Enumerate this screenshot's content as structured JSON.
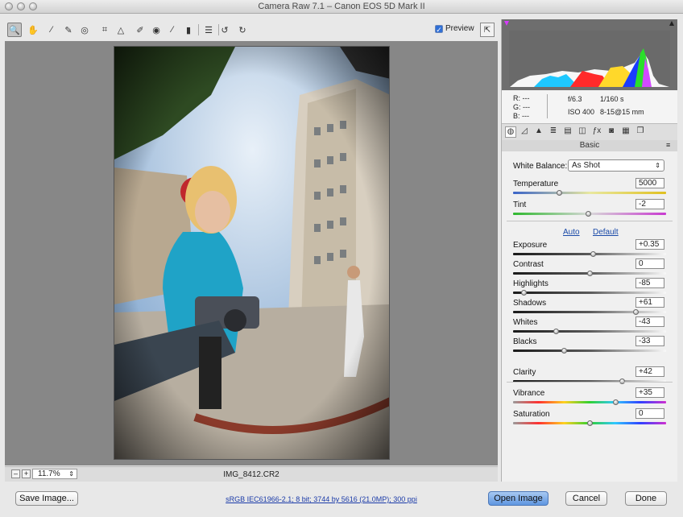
{
  "window": {
    "title": "Camera Raw 7.1  –  Canon EOS 5D Mark II"
  },
  "toolbar": {
    "tools": [
      {
        "name": "zoom-tool",
        "glyph": "🔍",
        "active": true
      },
      {
        "name": "hand-tool",
        "glyph": "✋"
      },
      {
        "name": "white-balance-tool",
        "glyph": "⁄"
      },
      {
        "name": "color-sampler-tool",
        "glyph": "✎"
      },
      {
        "name": "targeted-adjustment-tool",
        "glyph": "◎"
      },
      {
        "name": "crop-tool",
        "glyph": "⌗"
      },
      {
        "name": "straighten-tool",
        "glyph": "△"
      },
      {
        "name": "spot-removal-tool",
        "glyph": "✐"
      },
      {
        "name": "red-eye-tool",
        "glyph": "◉"
      },
      {
        "name": "adjustment-brush-tool",
        "glyph": "∕"
      },
      {
        "name": "graduated-filter-tool",
        "glyph": "▮"
      },
      {
        "name": "preferences-tool",
        "glyph": "☰"
      },
      {
        "name": "rotate-left-tool",
        "glyph": "↺"
      },
      {
        "name": "rotate-right-tool",
        "glyph": "↻"
      }
    ],
    "preview_label": "Preview",
    "preview_checked": true
  },
  "statusbar": {
    "zoom_out": "–",
    "zoom_in": "+",
    "zoom": "11.7%",
    "filename": "IMG_8412.CR2"
  },
  "readout": {
    "r_label": "R:",
    "r_value": "---",
    "g_label": "G:",
    "g_value": "---",
    "b_label": "B:",
    "b_value": "---",
    "aperture": "f/6.3",
    "shutter": "1/160 s",
    "iso": "ISO 400",
    "lens": "8-15@15 mm"
  },
  "panel": {
    "section_title": "Basic",
    "white_balance": {
      "label": "White Balance:",
      "value": "As Shot"
    },
    "auto_label": "Auto",
    "default_label": "Default",
    "sliders": [
      {
        "id": "temperature",
        "label": "Temperature",
        "value": "5000",
        "position": 0.3,
        "track": "temp"
      },
      {
        "id": "tint",
        "label": "Tint",
        "value": "-2",
        "position": 0.49,
        "track": "tint"
      },
      {
        "id": "exposure",
        "label": "Exposure",
        "value": "+0.35",
        "position": 0.52,
        "track": "dark"
      },
      {
        "id": "contrast",
        "label": "Contrast",
        "value": "0",
        "position": 0.5,
        "track": "dark"
      },
      {
        "id": "highlights",
        "label": "Highlights",
        "value": "-85",
        "position": 0.07,
        "track": "dark"
      },
      {
        "id": "shadows",
        "label": "Shadows",
        "value": "+61",
        "position": 0.8,
        "track": "dark"
      },
      {
        "id": "whites",
        "label": "Whites",
        "value": "-43",
        "position": 0.28,
        "track": "dark"
      },
      {
        "id": "blacks",
        "label": "Blacks",
        "value": "-33",
        "position": 0.33,
        "track": "dark"
      },
      {
        "id": "clarity",
        "label": "Clarity",
        "value": "+42",
        "position": 0.71,
        "track": "dark"
      },
      {
        "id": "vibrance",
        "label": "Vibrance",
        "value": "+35",
        "position": 0.67,
        "track": "rainbow"
      },
      {
        "id": "saturation",
        "label": "Saturation",
        "value": "0",
        "position": 0.5,
        "track": "rainbow"
      }
    ]
  },
  "bottom": {
    "save_label": "Save Image...",
    "workflow_info": "sRGB IEC61966-2.1; 8 bit; 3744 by 5616 (21.0MP); 300 ppi",
    "open_label": "Open Image",
    "cancel_label": "Cancel",
    "done_label": "Done"
  },
  "colors": {
    "accent": "#5f96e0",
    "canvas": "#878787"
  }
}
